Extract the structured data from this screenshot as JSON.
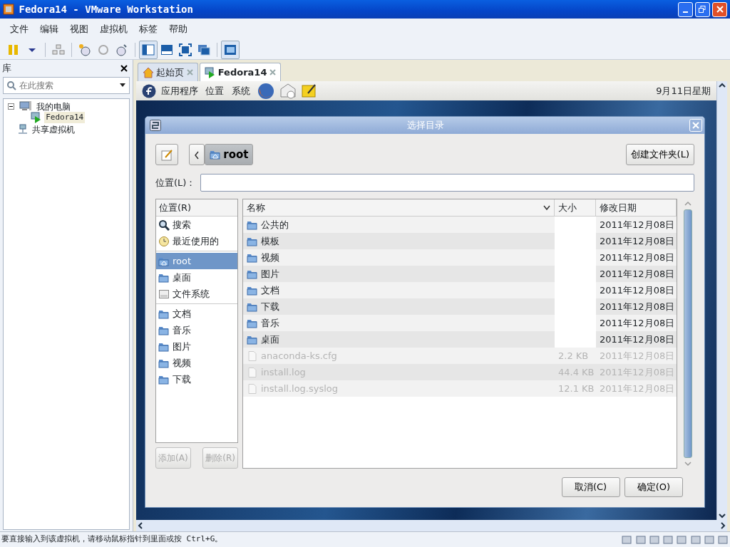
{
  "window": {
    "title": "Fedora14 - VMware Workstation"
  },
  "menu": [
    "文件",
    "编辑",
    "视图",
    "虚拟机",
    "标签",
    "帮助"
  ],
  "library": {
    "title": "库",
    "search": {
      "placeholder": "在此搜索"
    },
    "tree": [
      {
        "label": "我的电脑",
        "expanded": true,
        "selected": false,
        "children": [
          {
            "label": "Fedora14",
            "selected": true
          }
        ]
      },
      {
        "label": "共享虚拟机",
        "selected": false
      }
    ]
  },
  "tabs": [
    {
      "label": "起始页",
      "selected": false
    },
    {
      "label": "Fedora14",
      "selected": true
    }
  ],
  "guest_panel": {
    "menus": [
      "应用程序",
      "位置",
      "系统"
    ],
    "clock": "9月11日星期"
  },
  "dialog": {
    "title": "选择目录",
    "path": [
      {
        "label": "root",
        "selected": true
      }
    ],
    "create_folder": "创建文件夹(L)",
    "location_label": "位置(L)：",
    "places": {
      "header": "位置(R)",
      "groups": [
        [
          {
            "label": "搜索",
            "kind": "search",
            "selected": false
          },
          {
            "label": "最近使用的",
            "kind": "recent",
            "selected": false
          }
        ],
        [
          {
            "label": "root",
            "kind": "home",
            "selected": true
          },
          {
            "label": "桌面",
            "kind": "folder",
            "selected": false
          },
          {
            "label": "文件系统",
            "kind": "drive",
            "selected": false
          }
        ],
        [
          {
            "label": "文档",
            "kind": "folder",
            "selected": false
          },
          {
            "label": "音乐",
            "kind": "folder",
            "selected": false
          },
          {
            "label": "图片",
            "kind": "folder",
            "selected": false
          },
          {
            "label": "视频",
            "kind": "folder",
            "selected": false
          },
          {
            "label": "下载",
            "kind": "folder",
            "selected": false
          }
        ]
      ]
    },
    "add": {
      "label": "添加(A)",
      "disabled": true
    },
    "remove": {
      "label": "删除(R)",
      "disabled": true
    },
    "files": {
      "columns": [
        "名称",
        "大小",
        "修改日期"
      ],
      "rows": [
        {
          "name": "公共的",
          "kind": "folder",
          "date": "2011年12月08日",
          "disabled": false
        },
        {
          "name": "模板",
          "kind": "folder",
          "date": "2011年12月08日",
          "disabled": false
        },
        {
          "name": "视频",
          "kind": "folder",
          "date": "2011年12月08日",
          "disabled": false
        },
        {
          "name": "图片",
          "kind": "folder",
          "date": "2011年12月08日",
          "disabled": false
        },
        {
          "name": "文档",
          "kind": "folder",
          "date": "2011年12月08日",
          "disabled": false
        },
        {
          "name": "下载",
          "kind": "folder",
          "date": "2011年12月08日",
          "disabled": false
        },
        {
          "name": "音乐",
          "kind": "folder",
          "date": "2011年12月08日",
          "disabled": false
        },
        {
          "name": "桌面",
          "kind": "folder",
          "date": "2011年12月08日",
          "disabled": false
        },
        {
          "name": "anaconda-ks.cfg",
          "kind": "file",
          "size": "2.2 KB",
          "date": "2011年12月08日",
          "disabled": true
        },
        {
          "name": "install.log",
          "kind": "file",
          "size": "44.4 KB",
          "date": "2011年12月08日",
          "disabled": true
        },
        {
          "name": "install.log.syslog",
          "kind": "file",
          "size": "12.1 KB",
          "date": "2011年12月08日",
          "disabled": true
        }
      ]
    },
    "buttons": [
      {
        "label": "取消(C)"
      },
      {
        "label": "确定(O)"
      }
    ]
  },
  "status_bar": "要直接输入到该虚拟机，请移动鼠标指针到里面或按 Ctrl+G。"
}
